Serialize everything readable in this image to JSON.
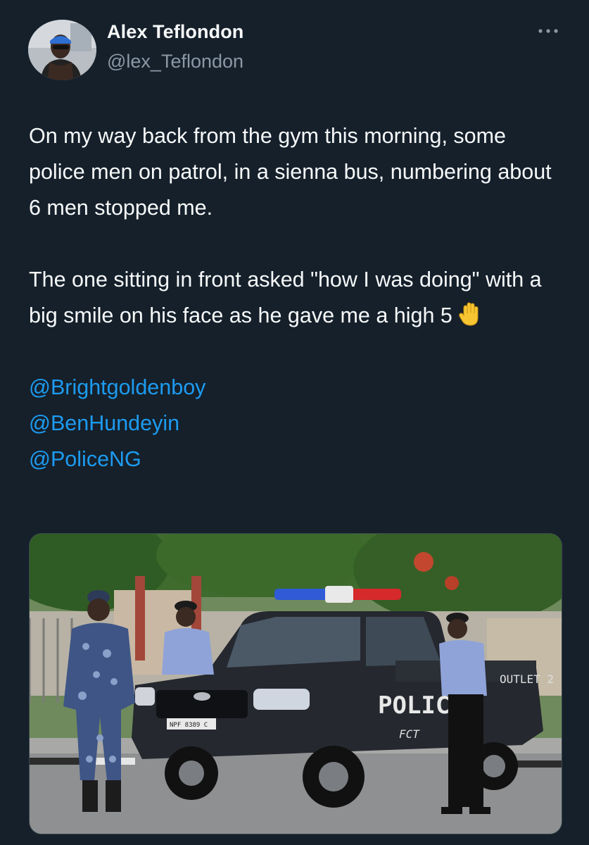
{
  "author": {
    "display_name": "Alex Teflondon",
    "handle": "@lex_Teflondon",
    "avatar_icon": "profile-avatar"
  },
  "menu": {
    "more_icon": "more-horizontal-icon"
  },
  "tweet": {
    "paragraph_1": "On my way back from the gym this morning, some police men on patrol, in a sienna bus, numbering about 6 men stopped me.",
    "paragraph_2": "The one sitting in front asked \"how I was doing\" with a big smile on his face as he gave me a high 5",
    "emoji": "raised-hand-emoji",
    "mentions": [
      "@Brightgoldenboy",
      "@BenHundeyin",
      "@PoliceNG"
    ]
  },
  "media": {
    "vehicle_text": {
      "door": "POLICE",
      "sub": "FCT",
      "plate": "NPF 8389 C",
      "rear": "OUTLET 2"
    }
  },
  "colors": {
    "background": "#15202b",
    "text": "#f7f9f9",
    "secondary": "#8b98a5",
    "link": "#1d9bf0",
    "border": "#38444d"
  }
}
